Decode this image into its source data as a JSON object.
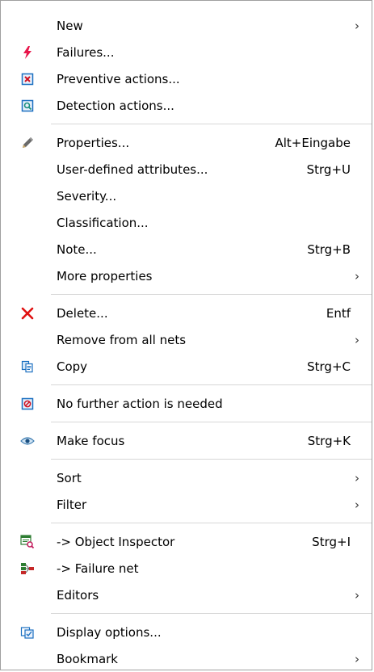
{
  "menu": {
    "items": [
      {
        "id": "new",
        "label": "New",
        "shortcut": "",
        "submenu": true,
        "icon": ""
      },
      {
        "id": "failures",
        "label": "Failures...",
        "shortcut": "",
        "submenu": false,
        "icon": "lightning-icon"
      },
      {
        "id": "preventive-actions",
        "label": "Preventive actions...",
        "shortcut": "",
        "submenu": false,
        "icon": "preventive-action-icon"
      },
      {
        "id": "detection-actions",
        "label": "Detection actions...",
        "shortcut": "",
        "submenu": false,
        "icon": "detection-action-icon"
      },
      {
        "id": "sep1",
        "separator": true
      },
      {
        "id": "properties",
        "label": "Properties...",
        "shortcut": "Alt+Eingabe",
        "submenu": false,
        "icon": "pencil-icon"
      },
      {
        "id": "user-defined-attributes",
        "label": "User-defined attributes...",
        "shortcut": "Strg+U",
        "submenu": false,
        "icon": ""
      },
      {
        "id": "severity",
        "label": "Severity...",
        "shortcut": "",
        "submenu": false,
        "icon": ""
      },
      {
        "id": "classification",
        "label": "Classification...",
        "shortcut": "",
        "submenu": false,
        "icon": ""
      },
      {
        "id": "note",
        "label": "Note...",
        "shortcut": "Strg+B",
        "submenu": false,
        "icon": ""
      },
      {
        "id": "more-properties",
        "label": "More properties",
        "shortcut": "",
        "submenu": true,
        "icon": ""
      },
      {
        "id": "sep2",
        "separator": true
      },
      {
        "id": "delete",
        "label": "Delete...",
        "shortcut": "Entf",
        "submenu": false,
        "icon": "delete-x-icon"
      },
      {
        "id": "remove-from-all-nets",
        "label": "Remove from all nets",
        "shortcut": "",
        "submenu": true,
        "icon": ""
      },
      {
        "id": "copy",
        "label": "Copy",
        "shortcut": "Strg+C",
        "submenu": false,
        "icon": "copy-icon"
      },
      {
        "id": "sep3",
        "separator": true
      },
      {
        "id": "no-further-action",
        "label": "No further action is needed",
        "shortcut": "",
        "submenu": false,
        "icon": "no-action-icon"
      },
      {
        "id": "sep4",
        "separator": true
      },
      {
        "id": "make-focus",
        "label": "Make focus",
        "shortcut": "Strg+K",
        "submenu": false,
        "icon": "eye-icon"
      },
      {
        "id": "sep5",
        "separator": true
      },
      {
        "id": "sort",
        "label": "Sort",
        "shortcut": "",
        "submenu": true,
        "icon": ""
      },
      {
        "id": "filter",
        "label": "Filter",
        "shortcut": "",
        "submenu": true,
        "icon": ""
      },
      {
        "id": "sep6",
        "separator": true
      },
      {
        "id": "object-inspector",
        "label": "-> Object Inspector",
        "shortcut": "Strg+I",
        "submenu": false,
        "icon": "object-inspector-icon"
      },
      {
        "id": "failure-net",
        "label": "-> Failure net",
        "shortcut": "",
        "submenu": false,
        "icon": "failure-net-icon"
      },
      {
        "id": "editors",
        "label": "Editors",
        "shortcut": "",
        "submenu": true,
        "icon": ""
      },
      {
        "id": "sep7",
        "separator": true
      },
      {
        "id": "display-options",
        "label": "Display options...",
        "shortcut": "",
        "submenu": false,
        "icon": "display-options-icon"
      },
      {
        "id": "bookmark",
        "label": "Bookmark",
        "shortcut": "",
        "submenu": true,
        "icon": ""
      }
    ],
    "submenu_glyph": "›"
  },
  "colors": {
    "lightning": "#e8164b",
    "delete": "#e01010",
    "blue": "#1a6fc0",
    "teal": "#1a8f7f",
    "separator": "#d7d7d7",
    "border": "#a0a0a0"
  }
}
